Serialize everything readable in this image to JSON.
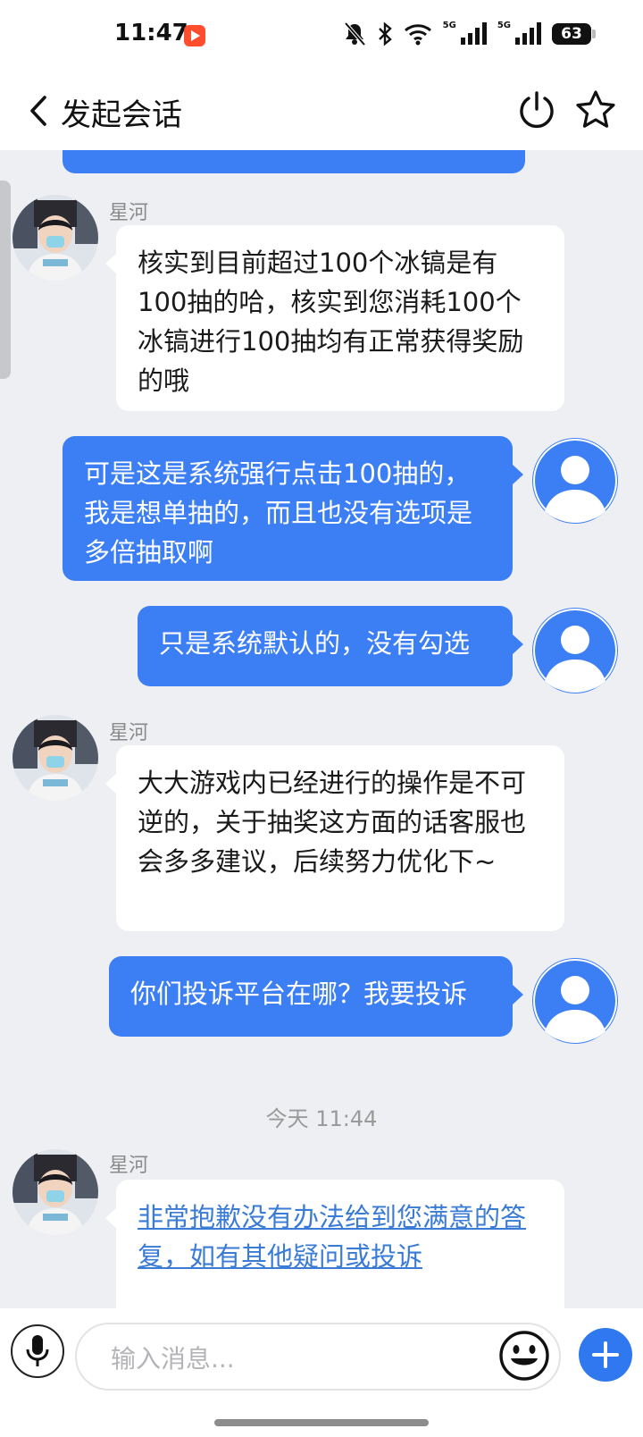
{
  "status_bar": {
    "time": "11:47",
    "network_1": "5G",
    "network_2": "5G",
    "battery": "63",
    "icons": [
      "video-app-icon",
      "mute-bell-icon",
      "bluetooth-icon",
      "wifi-icon",
      "signal-icon",
      "battery-icon"
    ]
  },
  "header": {
    "title": "发起会话",
    "icons": [
      "back-icon",
      "power-icon",
      "star-icon"
    ]
  },
  "messages": [
    {
      "side": "agent",
      "sender": "星河",
      "text": "核实到目前超过100个冰镐是有100抽的哈，核实到您消耗100个冰镐进行100抽均有正常获得奖励的哦"
    },
    {
      "side": "user",
      "text": "可是这是系统强行点击100抽的，我是想单抽的，而且也没有选项是多倍抽取啊"
    },
    {
      "side": "user",
      "text": "只是系统默认的，没有勾选"
    },
    {
      "side": "agent",
      "sender": "星河",
      "text": "大大游戏内已经进行的操作是不可逆的，关于抽奖这方面的话客服也会多多建议，后续努力优化下~"
    },
    {
      "side": "user",
      "text": "你们投诉平台在哪？我要投诉"
    },
    {
      "side": "timestamp",
      "text": "今天 11:44"
    },
    {
      "side": "agent",
      "sender": "星河",
      "text": "非常抱歉没有办法给到您满意的答复，如有其他疑问或投诉",
      "is_link": true
    }
  ],
  "input": {
    "placeholder": "输入消息..."
  },
  "colors": {
    "accent": "#3c7ff5",
    "background": "#eeeff2",
    "link": "#3a7bd5"
  }
}
